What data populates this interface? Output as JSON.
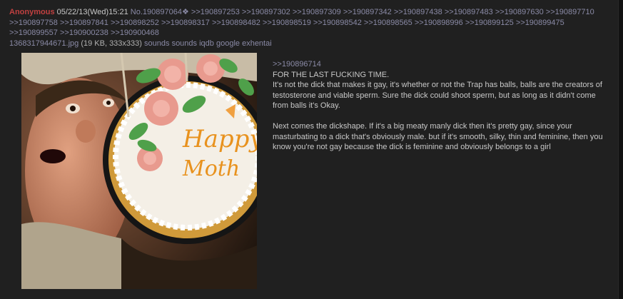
{
  "post": {
    "name": "Anonymous",
    "datetime": "05/22/13(Wed)15:21",
    "post_number": "No.190897064",
    "replies": [
      ">>190897253",
      ">>190897302",
      ">>190897309",
      ">>190897342",
      ">>190897438",
      ">>190897483",
      ">>190897630",
      ">>190897710",
      ">>190897758",
      ">>190897841",
      ">>190898252",
      ">>190898317",
      ">>190898482",
      ">>190898519",
      ">>190898542",
      ">>190898565",
      ">>190898996",
      ">>190899125",
      ">>190899475",
      ">>190899557",
      ">>190900238",
      ">>190900468"
    ],
    "file": {
      "filename": "1368317944671.jpg",
      "meta": "(19 KB, 333x333)",
      "links": [
        "sounds",
        "sounds",
        "iqdb",
        "google",
        "exhentai"
      ]
    },
    "image_text": {
      "line1": "Happy",
      "line2": "Moth"
    },
    "body": {
      "quote": ">>190896714",
      "paragraphs": [
        "FOR THE LAST FUCKING TIME.\nIt's not the dick that makes it gay, it's whether or not the Trap has balls, balls are the creators of testosterone and viable sperm. Sure the dick could shoot sperm, but as long as it didn't come from balls it's Okay.",
        "Next comes the dickshape. If it's a big meaty manly dick then it's pretty gay, since your masturbating to a dick that's obviously male. but if it's smooth, silky, thin and feminine, then you know you're not gay because the dick is feminine and obviously belongs to a girl"
      ]
    }
  }
}
